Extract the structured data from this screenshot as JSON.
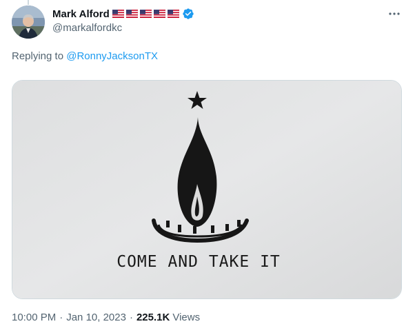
{
  "tweet": {
    "author_name": "Mark Alford",
    "author_handle": "@markalfordkc",
    "flags": [
      "us-flag",
      "us-flag",
      "us-flag",
      "us-flag",
      "us-flag"
    ],
    "verified_icon": "verified-badge-icon",
    "more_icon": "more-horizontal-icon",
    "reply_prefix": "Replying to ",
    "reply_to": "@RonnyJacksonTX",
    "image_caption": "COME AND TAKE IT",
    "time": "10:00 PM",
    "separator": "·",
    "date": "Jan 10, 2023",
    "views_count": "225.1K",
    "views_label": "Views"
  },
  "colors": {
    "text": "#0f1419",
    "secondary": "#536471",
    "link": "#1d9bf0",
    "border": "#cfd9de",
    "verified": "#1d9bf0"
  }
}
